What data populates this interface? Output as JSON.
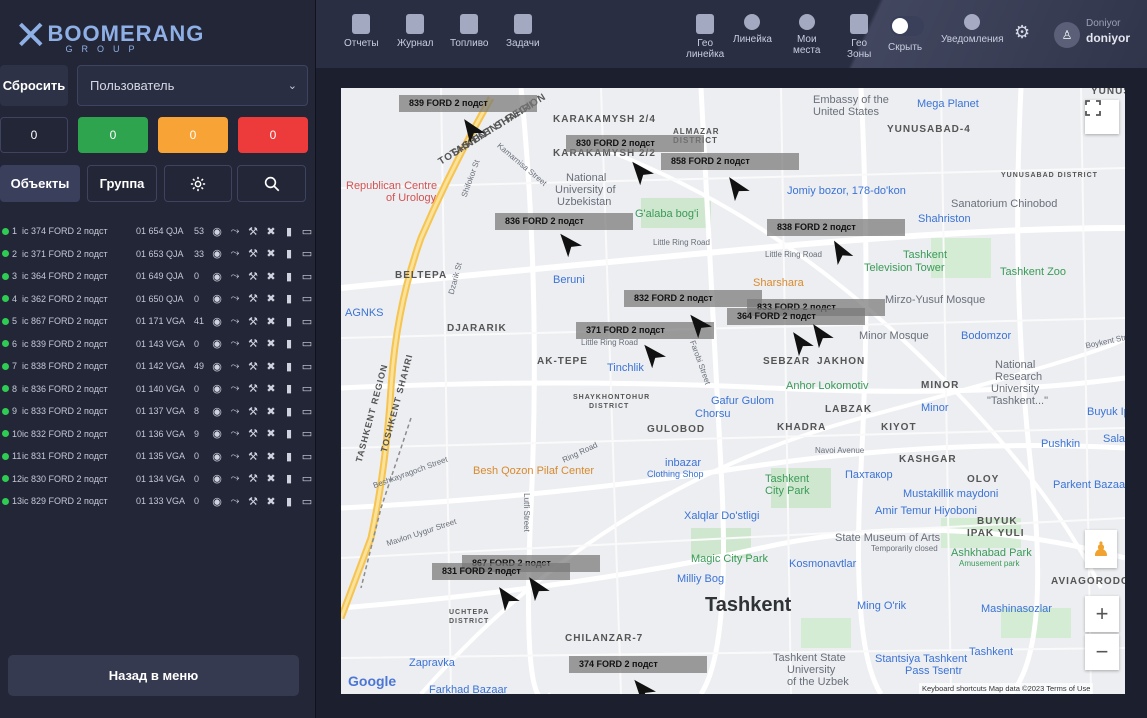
{
  "brand": {
    "name": "BOOMERANG",
    "sub": "GROUP"
  },
  "sidebar": {
    "reset_label": "Сбросить",
    "user_select": "Пользователь",
    "counters": {
      "total": "0",
      "green": "0",
      "orange": "0",
      "red": "0"
    },
    "tabs": {
      "objects": "Объекты",
      "group": "Группа"
    },
    "vehicles": [
      {
        "idx": "1",
        "name": "ic 374 FORD 2 подст",
        "plate": "01 654 QJA",
        "speed": "53"
      },
      {
        "idx": "2",
        "name": "ic 371 FORD 2 подст",
        "plate": "01 653 QJA",
        "speed": "33"
      },
      {
        "idx": "3",
        "name": "ic 364 FORD 2 подст",
        "plate": "01 649 QJA",
        "speed": "0"
      },
      {
        "idx": "4",
        "name": "ic 362 FORD 2 подст",
        "plate": "01 650 QJA",
        "speed": "0"
      },
      {
        "idx": "5",
        "name": "ic 867 FORD 2 подст",
        "plate": "01 171 VGA",
        "speed": "41"
      },
      {
        "idx": "6",
        "name": "ic 839 FORD 2 подст",
        "plate": "01 143 VGA",
        "speed": "0"
      },
      {
        "idx": "7",
        "name": "ic 838 FORD 2 подст",
        "plate": "01 142 VGA",
        "speed": "49"
      },
      {
        "idx": "8",
        "name": "ic 836 FORD 2 подст",
        "plate": "01 140 VGA",
        "speed": "0"
      },
      {
        "idx": "9",
        "name": "ic 833 FORD 2 подст",
        "plate": "01 137 VGA",
        "speed": "8"
      },
      {
        "idx": "10",
        "name": "ic 832 FORD 2 подст",
        "plate": "01 136 VGA",
        "speed": "9"
      },
      {
        "idx": "11",
        "name": "ic 831 FORD 2 подст",
        "plate": "01 135 VGA",
        "speed": "0"
      },
      {
        "idx": "12",
        "name": "ic 830 FORD 2 подст",
        "plate": "01 134 VGA",
        "speed": "0"
      },
      {
        "idx": "13",
        "name": "ic 829 FORD 2 подст",
        "plate": "01 133 VGA",
        "speed": "0"
      }
    ],
    "back_label": "Назад в меню"
  },
  "topbar": {
    "reports": "Отчеты",
    "journal": "Журнал",
    "fuel": "Топливо",
    "tasks": "Задачи",
    "geo_line_1": "Гео",
    "geo_line_2": "линейка",
    "ruler": "Линейка",
    "places_1": "Мои",
    "places_2": "места",
    "zones_1": "Гео",
    "zones_2": "Зоны",
    "hide": "Скрыть",
    "notifications": "Уведомления",
    "user_top": "Doniyor",
    "user_name": "doniyor"
  },
  "map": {
    "city": "Tashkent",
    "google": "Google",
    "attribution": "Keyboard shortcuts   Map data ©2023   Terms of Use",
    "labels": {
      "karakamysh24": "KARAKAMYSH 2/4",
      "karakamysh": "KARAKAMYSH 2/2",
      "almazar": "ALMAZAR",
      "district": "DISTRICT",
      "embassy": "Embassy of the",
      "us": "United States",
      "megaplanet": "Mega Planet",
      "yunusabad4": "YUNUSABAD-4",
      "yunusabad": "YUNUSABAD-",
      "yunusabad_district": "YUNUSABAD DISTRICT",
      "sanatorium": "Sanatorium Chinobod",
      "jomiy": "Jomiy bozor, 178-do'kon",
      "shahriston": "Shahriston",
      "republican": "Republican Centre",
      "urology": "of Urology",
      "natuni1": "National",
      "natuni2": "University of",
      "natuni3": "Uzbekistan",
      "galaba": "G'alaba bog'i",
      "tashkent_tv1": "Tashkent",
      "tashkent_tv2": "Television Tower",
      "zoo": "Tashkent Zoo",
      "beltepa": "BELTEPA",
      "beruni": "Beruni",
      "sharshara": "Sharshara",
      "agnks": "AGNKS",
      "djararik": "DJARARIK",
      "mirzo": "Mirzo-Yusuf Mosque",
      "minor_mosque": "Minor Mosque",
      "bodomzor": "Bodomzor",
      "aktepe": "AK-TEPE",
      "sebzar": "SEBZAR",
      "jakhon": "JAKHON",
      "tinchlik": "Tinchlik",
      "anhor": "Anhor Lokomotiv",
      "minor": "MINOR",
      "natres1": "National",
      "natres2": "Research",
      "natres3": "University",
      "natres4": "\"Tashkent...\"",
      "shaykh": "SHAYKHONTOHUR",
      "shaykh_d": "DISTRICT",
      "gafur": "Gafur Gulom",
      "chorsu": "Chorsu",
      "labzak": "LABZAK",
      "minor_metro": "Minor",
      "buyuk": "Buyuk Ip",
      "gulobod": "GULOBOD",
      "khadra": "KHADRA",
      "kiyot": "KIYOT",
      "pushkin": "Pushkin",
      "salar": "Salar",
      "navoi": "Navoi Avenue",
      "kashgar": "KASHGAR",
      "region": "TASHKENT REGION",
      "toshkent_shahri": "TOSHKENT SHAHRI",
      "besh": "Besh Qozon Pilaf Center",
      "inbazar1": "inbazar",
      "inbazar2": "Clothing Shop",
      "tpark1": "Tashkent",
      "tpark2": "City Park",
      "paxtakor": "Пахтакор",
      "oloy": "OLOY",
      "parkent": "Parkent Bazaar",
      "mustaqillik": "Mustakillik maydoni",
      "amir": "Amir Temur Hiyoboni",
      "xalqlar": "Xalqlar Do'stligi",
      "buyuk_yuli1": "BUYUK",
      "buyuk_yuli2": "IPAK YULI",
      "statemuseum": "State Museum of Arts",
      "temp_closed": "Temporarily closed",
      "ashkhabad": "Ashkhabad Park",
      "amusement": "Amusement park",
      "magic": "Magic City Park",
      "milliy": "Milliy Bog",
      "kosmonavtlar": "Kosmonavtlar",
      "aviagorodok": "AVIAGORODOK-",
      "uchtepa": "UCHTEPA",
      "uchtepa_d": "DISTRICT",
      "ming": "Ming O'rik",
      "mashinasozlar": "Mashinasozlar",
      "chilanzar": "CHILANZAR-7",
      "zapravka": "Zapravka",
      "tsu1": "Tashkent State",
      "tsu2": "University",
      "tsu3": "of the Uzbek",
      "stantsiya1": "Stantsiya Tashkent",
      "stantsiya2": "Pass Tsentr",
      "tashkent_metro": "Tashkent",
      "farkhad": "Farkhad Bazaar",
      "little_ring": "Little Ring Road",
      "little_ring2": "Little Ring Road",
      "little_ring3": "Little Ring Road",
      "toshkent_road": "TOSHKENT SHAHRI",
      "tashkent_region_road": "TASHKENT REGION",
      "street_shifokor": "Shifokor St",
      "street_kamarnisa": "Kamarnisa Street",
      "street_lutfi": "Lutfi Street",
      "street_beshkay": "Beshkayragoch Street",
      "street_mavlon": "Mavlon Uygur Street",
      "street_dzharik": "Dzarik St",
      "street_farobi": "Farobi Street",
      "street_boykent": "Boykent Street",
      "street_ring": "Ring Road"
    },
    "vehicle_tags": {
      "v839": "839 FORD 2 подст",
      "v830": "830 FORD 2 подст",
      "v858": "858 FORD 2 подст",
      "v836": "836 FORD 2 подст",
      "v838": "838 FORD 2 подст",
      "v832": "832 FORD 2 подст",
      "v833": "833 FORD 2 подст",
      "v364": "364 FORD 2 подст",
      "v371": "371 FORD 2 подст",
      "v867": "867 FORD 2 подст",
      "v831": "831 FORD 2 подст",
      "v374": "374 FORD 2 подст"
    }
  }
}
